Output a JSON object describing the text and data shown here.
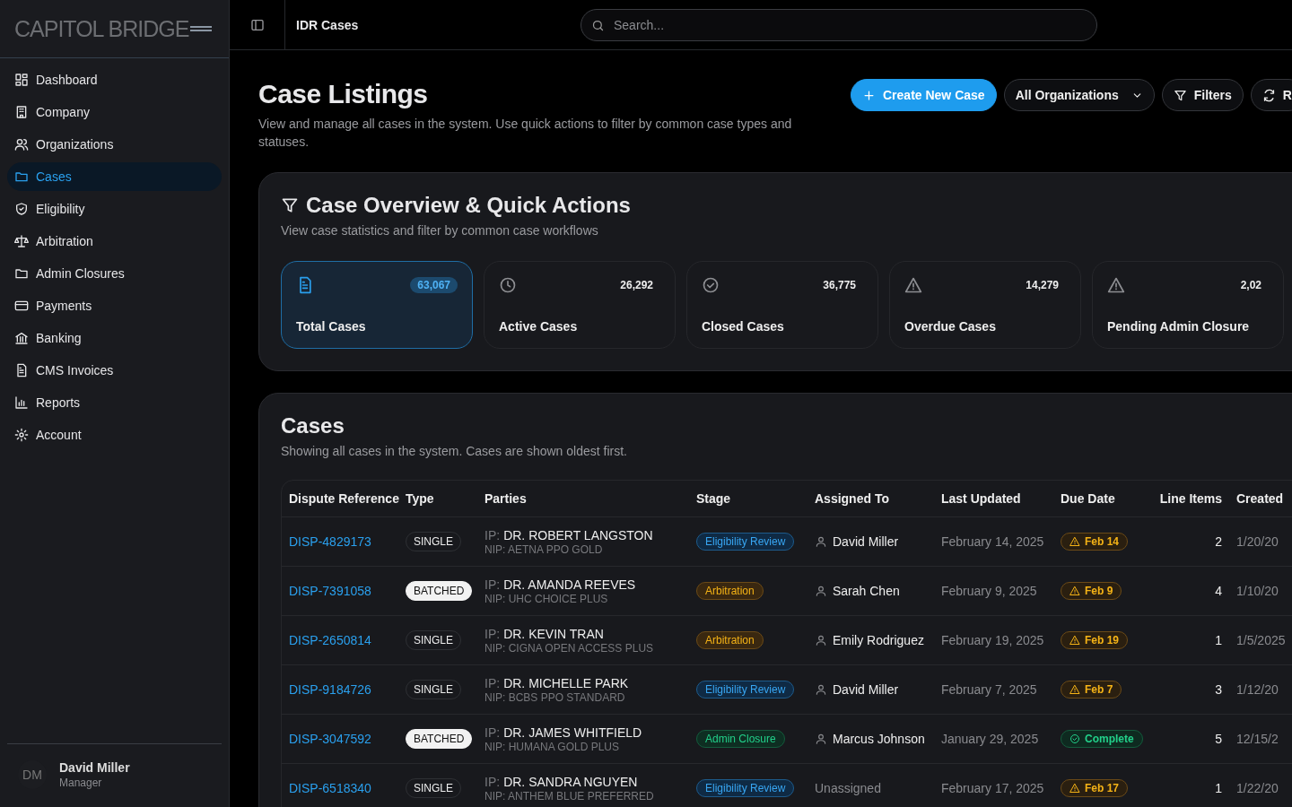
{
  "sidebar": {
    "logo": "CAPITOL BRIDGE",
    "items": [
      {
        "label": "Dashboard",
        "selected": false
      },
      {
        "label": "Company",
        "selected": false
      },
      {
        "label": "Organizations",
        "selected": false
      },
      {
        "label": "Cases",
        "selected": true
      },
      {
        "label": "Eligibility",
        "selected": false
      },
      {
        "label": "Arbitration",
        "selected": false
      },
      {
        "label": "Admin Closures",
        "selected": false
      },
      {
        "label": "Payments",
        "selected": false
      },
      {
        "label": "Banking",
        "selected": false
      },
      {
        "label": "CMS Invoices",
        "selected": false
      },
      {
        "label": "Reports",
        "selected": false
      },
      {
        "label": "Account",
        "selected": false
      }
    ],
    "user": {
      "initials": "DM",
      "name": "David Miller",
      "role": "Manager"
    }
  },
  "topbar": {
    "title": "IDR Cases",
    "search": {
      "placeholder": "Search..."
    }
  },
  "header": {
    "title": "Case Listings",
    "subtitle": "View and manage all cases in the system. Use quick actions to filter by common case types and statuses.",
    "actions": {
      "create": "Create New Case",
      "organization": "All Organizations",
      "filters": "Filters",
      "refresh": "R"
    }
  },
  "overview": {
    "title": "Case Overview & Quick Actions",
    "subtitle": "View case statistics and filter by common case workflows",
    "stats": [
      {
        "label": "Total Cases",
        "count": "63,067",
        "selected": true
      },
      {
        "label": "Active Cases",
        "count": "26,292",
        "selected": false
      },
      {
        "label": "Closed Cases",
        "count": "36,775",
        "selected": false
      },
      {
        "label": "Overdue Cases",
        "count": "14,279",
        "selected": false
      },
      {
        "label": "Pending Admin Closure",
        "count": "2,02",
        "selected": false
      }
    ]
  },
  "cases": {
    "title": "Cases",
    "subtitle": "Showing all cases in the system. Cases are shown oldest first.",
    "columns": [
      "Dispute Reference",
      "Type",
      "Parties",
      "Stage",
      "Assigned To",
      "Last Updated",
      "Due Date",
      "Line Items",
      "Created"
    ],
    "rows": [
      {
        "reference": "DISP-4829173",
        "type": {
          "label": "SINGLE",
          "kind": "single"
        },
        "ip_label": "IP:",
        "ip": "DR. ROBERT LANGSTON",
        "nip": "NIP: AETNA PPO GOLD",
        "stage": {
          "label": "Eligibility Review",
          "kind": "eligibility"
        },
        "assignee": "David Miller",
        "unassigned": false,
        "updated": "February 14, 2025",
        "due": {
          "label": "Feb 14",
          "kind": "warning"
        },
        "line_items": "2",
        "created": "1/20/20"
      },
      {
        "reference": "DISP-7391058",
        "type": {
          "label": "BATCHED",
          "kind": "batched"
        },
        "ip_label": "IP:",
        "ip": "DR. AMANDA REEVES",
        "nip": "NIP: UHC CHOICE PLUS",
        "stage": {
          "label": "Arbitration",
          "kind": "arbitration"
        },
        "assignee": "Sarah Chen",
        "unassigned": false,
        "updated": "February 9, 2025",
        "due": {
          "label": "Feb 9",
          "kind": "warning"
        },
        "line_items": "4",
        "created": "1/10/20"
      },
      {
        "reference": "DISP-2650814",
        "type": {
          "label": "SINGLE",
          "kind": "single"
        },
        "ip_label": "IP:",
        "ip": "DR. KEVIN TRAN",
        "nip": "NIP: CIGNA OPEN ACCESS PLUS",
        "stage": {
          "label": "Arbitration",
          "kind": "arbitration"
        },
        "assignee": "Emily Rodriguez",
        "unassigned": false,
        "updated": "February 19, 2025",
        "due": {
          "label": "Feb 19",
          "kind": "warning"
        },
        "line_items": "1",
        "created": "1/5/2025"
      },
      {
        "reference": "DISP-9184726",
        "type": {
          "label": "SINGLE",
          "kind": "single"
        },
        "ip_label": "IP:",
        "ip": "DR. MICHELLE PARK",
        "nip": "NIP: BCBS PPO STANDARD",
        "stage": {
          "label": "Eligibility Review",
          "kind": "eligibility"
        },
        "assignee": "David Miller",
        "unassigned": false,
        "updated": "February 7, 2025",
        "due": {
          "label": "Feb 7",
          "kind": "warning"
        },
        "line_items": "3",
        "created": "1/12/20"
      },
      {
        "reference": "DISP-3047592",
        "type": {
          "label": "BATCHED",
          "kind": "batched"
        },
        "ip_label": "IP:",
        "ip": "DR. JAMES WHITFIELD",
        "nip": "NIP: HUMANA GOLD PLUS",
        "stage": {
          "label": "Admin Closure",
          "kind": "closure"
        },
        "assignee": "Marcus Johnson",
        "unassigned": false,
        "updated": "January 29, 2025",
        "due": {
          "label": "Complete",
          "kind": "complete"
        },
        "line_items": "5",
        "created": "12/15/2"
      },
      {
        "reference": "DISP-6518340",
        "type": {
          "label": "SINGLE",
          "kind": "single"
        },
        "ip_label": "IP:",
        "ip": "DR. SANDRA NGUYEN",
        "nip": "NIP: ANTHEM BLUE PREFERRED",
        "stage": {
          "label": "Eligibility Review",
          "kind": "eligibility"
        },
        "assignee": "Unassigned",
        "unassigned": true,
        "updated": "February 17, 2025",
        "due": {
          "label": "Feb 17",
          "kind": "warning"
        },
        "line_items": "1",
        "created": "1/22/20"
      }
    ]
  }
}
